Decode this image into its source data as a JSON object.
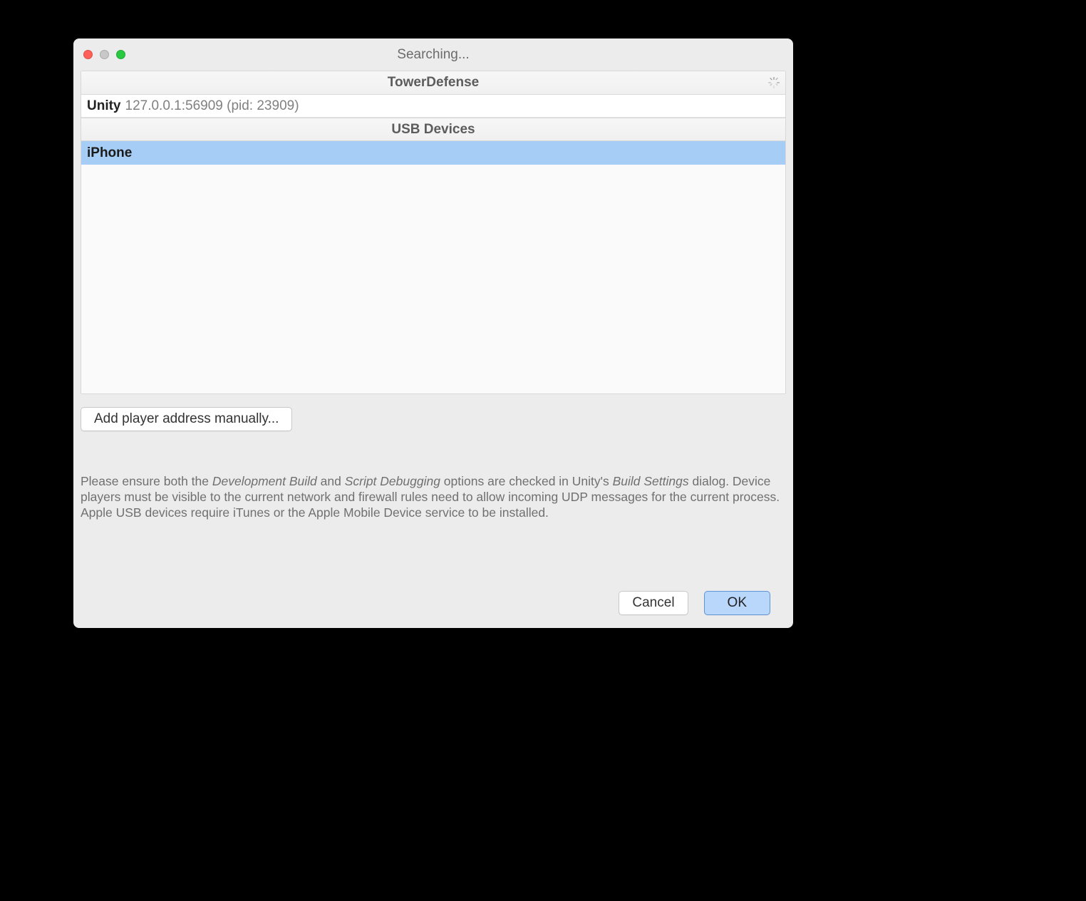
{
  "window": {
    "title": "Searching..."
  },
  "groups": [
    {
      "header": "TowerDefense",
      "rows": [
        {
          "bold": "Unity",
          "faded": "127.0.0.1:56909 (pid: 23909)",
          "selected": false
        }
      ]
    },
    {
      "header": "USB Devices",
      "rows": [
        {
          "bold": "iPhone",
          "faded": "",
          "selected": true
        }
      ]
    }
  ],
  "buttons": {
    "add_manual": "Add player address manually...",
    "cancel": "Cancel",
    "ok": "OK"
  },
  "help": {
    "p1a": "Please ensure both the ",
    "em1": "Development Build",
    "p1b": "  and ",
    "em2": "Script Debugging",
    "p1c": "  options are checked in Unity's ",
    "em3": "Build Settings",
    "p1d": " dialog. Device players must be visible to the current network and firewall rules need to allow incoming UDP messages for the current process. Apple USB devices require iTunes or the Apple Mobile Device service to be installed."
  }
}
